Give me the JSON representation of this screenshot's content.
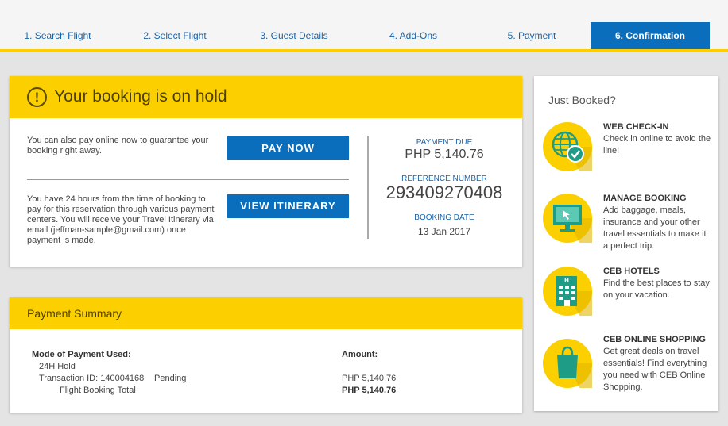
{
  "steps": [
    {
      "label": "1. Search Flight"
    },
    {
      "label": "2. Select Flight"
    },
    {
      "label": "3. Guest Details"
    },
    {
      "label": "4. Add-Ons"
    },
    {
      "label": "5. Payment"
    },
    {
      "label": "6. Confirmation"
    }
  ],
  "booking": {
    "title": "Your booking is on hold",
    "pay_online_text": "You can also pay online now to guarantee your booking right away.",
    "pay_now_label": "PAY NOW",
    "hold_text": "You have 24 hours from the time of booking to pay for this reservation through various payment centers. You will receive your Travel Itinerary via email (jeffman-sample@gmail.com) once payment is made.",
    "view_itinerary_label": "VIEW ITINERARY",
    "payment_due_label": "PAYMENT DUE",
    "payment_due_value": "PHP 5,140.76",
    "reference_label": "REFERENCE NUMBER",
    "reference_value": "293409270408",
    "booking_date_label": "BOOKING DATE",
    "booking_date_value": "13 Jan 2017"
  },
  "payment_summary": {
    "title": "Payment Summary",
    "mode_label": "Mode of Payment Used:",
    "amount_label": "Amount:",
    "mode_value": "24H Hold",
    "transaction": "Transaction ID: 140004168",
    "status": "Pending",
    "flight_total_label": "Flight Booking Total",
    "transaction_amount": "PHP 5,140.76",
    "total_amount": "PHP 5,140.76"
  },
  "sidebar": {
    "title": "Just Booked?",
    "items": [
      {
        "title": "WEB CHECK-IN",
        "desc": "Check in online to avoid the line!",
        "icon": "globe-check-icon"
      },
      {
        "title": "MANAGE BOOKING",
        "desc": "Add baggage, meals, insurance and your other travel essentials to make it a perfect trip.",
        "icon": "monitor-icon"
      },
      {
        "title": "CEB HOTELS",
        "desc": "Find the best places to stay on your vacation.",
        "icon": "hotel-icon"
      },
      {
        "title": "CEB ONLINE SHOPPING",
        "desc": "Get great deals on travel essentials! Find everything you need with CEB Online Shopping.",
        "icon": "shopping-bag-icon"
      }
    ]
  },
  "colors": {
    "accent_yellow": "#fcd000",
    "primary_blue": "#0a6ebd",
    "link_blue": "#1a63a8",
    "icon_teal": "#1e9c86"
  }
}
